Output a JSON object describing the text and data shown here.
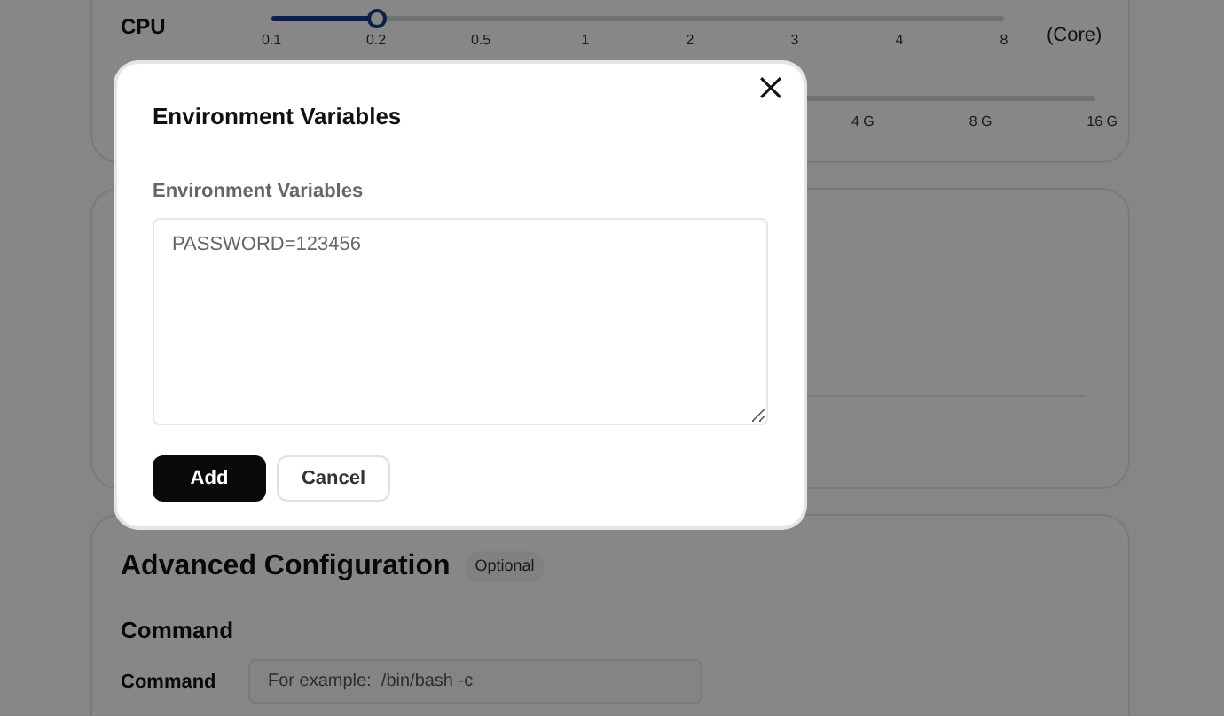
{
  "resources": {
    "cpu": {
      "label": "CPU",
      "level": 0.143,
      "ticks": [
        "0.1",
        "0.2",
        "0.5",
        "1",
        "2",
        "3",
        "4",
        "8"
      ],
      "unit": "(Core)"
    },
    "memory": {
      "ticks": [
        "4 G",
        "8 G",
        "16 G"
      ]
    }
  },
  "advanced": {
    "title": "Advanced Configuration",
    "badge": "Optional",
    "section": "Command",
    "field": {
      "label": "Command",
      "placeholder": "For example:  /bin/bash -c"
    }
  },
  "dialog": {
    "title": "Environment Variables",
    "field_label": "Environment Variables",
    "placeholder": "PASSWORD=123456",
    "buttons": [
      {
        "label": "Add",
        "kind": "primary"
      },
      {
        "label": "Cancel",
        "kind": "secondary"
      }
    ]
  }
}
